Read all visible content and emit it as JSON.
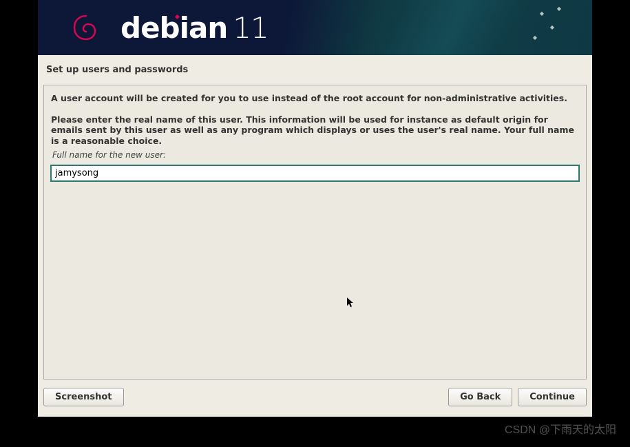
{
  "header": {
    "brand": "debian",
    "version": "11"
  },
  "page": {
    "title": "Set up users and passwords"
  },
  "content": {
    "instruction1": "A user account will be created for you to use instead of the root account for non-administrative activities.",
    "instruction2": "Please enter the real name of this user. This information will be used for instance as default origin for emails sent by this user as well as any program which displays or uses the user's real name. Your full name is a reasonable choice.",
    "field_label": "Full name for the new user:",
    "input_value": "jamysong"
  },
  "buttons": {
    "screenshot": "Screenshot",
    "go_back": "Go Back",
    "continue": "Continue"
  },
  "watermark": "CSDN @下雨天的太阳"
}
